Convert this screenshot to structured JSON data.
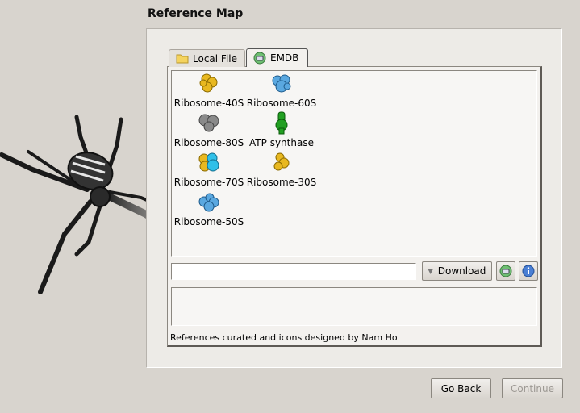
{
  "page": {
    "title": "Reference Map"
  },
  "tabs": [
    {
      "label": "Local File",
      "icon": "folder-icon",
      "active": false
    },
    {
      "label": "EMDB",
      "icon": "emdb-icon",
      "active": true
    }
  ],
  "maps": [
    {
      "label": "Ribosome-40S",
      "color": "#e8b820"
    },
    {
      "label": "Ribosome-60S",
      "color": "#5aa8e0"
    },
    {
      "label": "Ribosome-80S",
      "color": "#8a8a8a"
    },
    {
      "label": "ATP synthase",
      "color": "#22a022"
    },
    {
      "label": "Ribosome-70S",
      "color": "#e8b820",
      "color2": "#30c0e8"
    },
    {
      "label": "Ribosome-30S",
      "color": "#e8b820"
    },
    {
      "label": "Ribosome-50S",
      "color": "#5aa8e0"
    }
  ],
  "download": {
    "label": "Download",
    "url_value": ""
  },
  "credits": "References curated and icons designed by Nam Ho",
  "nav": {
    "back": "Go Back",
    "continue": "Continue",
    "continue_enabled": false
  }
}
